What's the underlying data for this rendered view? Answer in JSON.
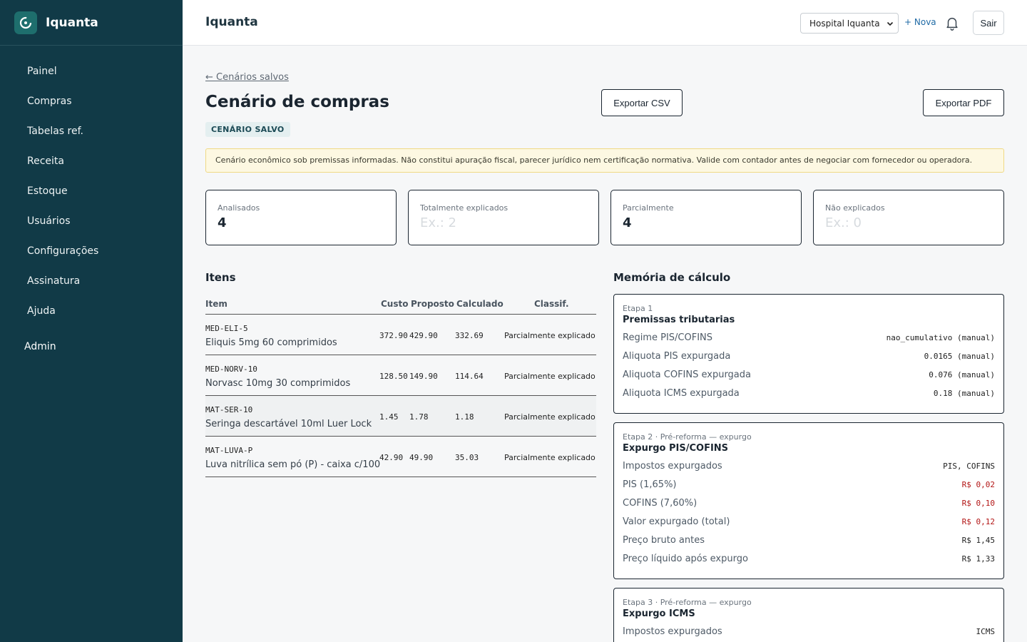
{
  "app": {
    "name": "Iquanta"
  },
  "sidebar": {
    "items": [
      {
        "label": "Painel"
      },
      {
        "label": "Compras"
      },
      {
        "label": "Tabelas ref."
      },
      {
        "label": "Receita"
      },
      {
        "label": "Estoque"
      },
      {
        "label": "Usuários"
      },
      {
        "label": "Configurações"
      },
      {
        "label": "Assinatura"
      },
      {
        "label": "Ajuda"
      }
    ],
    "admin": "Admin"
  },
  "topbar": {
    "title": "Iquanta",
    "hospital_selected": "Hospital Iquanta",
    "new_label": "+ Nova",
    "logout_label": "Sair"
  },
  "page": {
    "back_link": "← Cenários salvos",
    "title": "Cenário de compras",
    "badge": "CENÁRIO SALVO",
    "export_csv": "Exportar CSV",
    "export_pdf": "Exportar PDF",
    "warning": "Cenário econômico sob premissas informadas. Não constitui apuração fiscal, parecer jurídico nem certificação normativa. Valide com contador antes de negociar com fornecedor ou operadora."
  },
  "summary": [
    {
      "label": "Analisados",
      "value": "4",
      "placeholder": false
    },
    {
      "label": "Totalmente explicados",
      "value": "Ex.: 2",
      "placeholder": true
    },
    {
      "label": "Parcialmente",
      "value": "4",
      "placeholder": false
    },
    {
      "label": "Não explicados",
      "value": "Ex.: 0",
      "placeholder": true
    }
  ],
  "items": {
    "title": "Itens",
    "columns": {
      "item": "Item",
      "custo": "Custo",
      "proposto": "Proposto",
      "calculado": "Calculado",
      "classif": "Classif."
    },
    "rows": [
      {
        "code": "MED-ELI-5",
        "name": "Eliquis 5mg 60 comprimidos",
        "custo": "372.90",
        "proposto": "429.90",
        "calculado": "332.69",
        "classif": "Parcialmente explicado"
      },
      {
        "code": "MED-NORV-10",
        "name": "Norvasc 10mg 30 comprimidos",
        "custo": "128.50",
        "proposto": "149.90",
        "calculado": "114.64",
        "classif": "Parcialmente explicado"
      },
      {
        "code": "MAT-SER-10",
        "name": "Seringa descartável 10ml Luer Lock",
        "custo": "1.45",
        "proposto": "1.78",
        "calculado": "1.18",
        "classif": "Parcialmente explicado"
      },
      {
        "code": "MAT-LUVA-P",
        "name": "Luva nitrílica sem pó (P) - caixa c/100",
        "custo": "42.90",
        "proposto": "49.90",
        "calculado": "35.03",
        "classif": "Parcialmente explicado"
      }
    ]
  },
  "memory": {
    "title": "Memória de cálculo",
    "stages": [
      {
        "label": "Etapa 1",
        "title": "Premissas tributarias",
        "rows": [
          {
            "k": "Regime PIS/COFINS",
            "v": "nao_cumulativo (manual)",
            "red": false
          },
          {
            "k": "Aliquota PIS expurgada",
            "v": "0.0165 (manual)",
            "red": false
          },
          {
            "k": "Aliquota COFINS expurgada",
            "v": "0.076 (manual)",
            "red": false
          },
          {
            "k": "Aliquota ICMS expurgada",
            "v": "0.18 (manual)",
            "red": false
          }
        ]
      },
      {
        "label": "Etapa 2 · Pré-reforma — expurgo",
        "title": "Expurgo PIS/COFINS",
        "rows": [
          {
            "k": "Impostos expurgados",
            "v": "PIS, COFINS",
            "red": false
          },
          {
            "k": "PIS (1,65%)",
            "v": "R$ 0,02",
            "red": true
          },
          {
            "k": "COFINS (7,60%)",
            "v": "R$ 0,10",
            "red": true
          },
          {
            "k": "Valor expurgado (total)",
            "v": "R$ 0,12",
            "red": true
          },
          {
            "k": "Preço bruto antes",
            "v": "R$ 1,45",
            "red": false
          },
          {
            "k": "Preço líquido após expurgo",
            "v": "R$ 1,33",
            "red": false
          }
        ]
      },
      {
        "label": "Etapa 3 · Pré-reforma — expurgo",
        "title": "Expurgo ICMS",
        "rows": [
          {
            "k": "Impostos expurgados",
            "v": "ICMS",
            "red": false
          }
        ]
      }
    ]
  },
  "colors": {
    "sidebar": "#113a47",
    "accent_link": "#1f6aa5",
    "negative": "#b31616",
    "warning_bg": "#fdf8e2"
  }
}
